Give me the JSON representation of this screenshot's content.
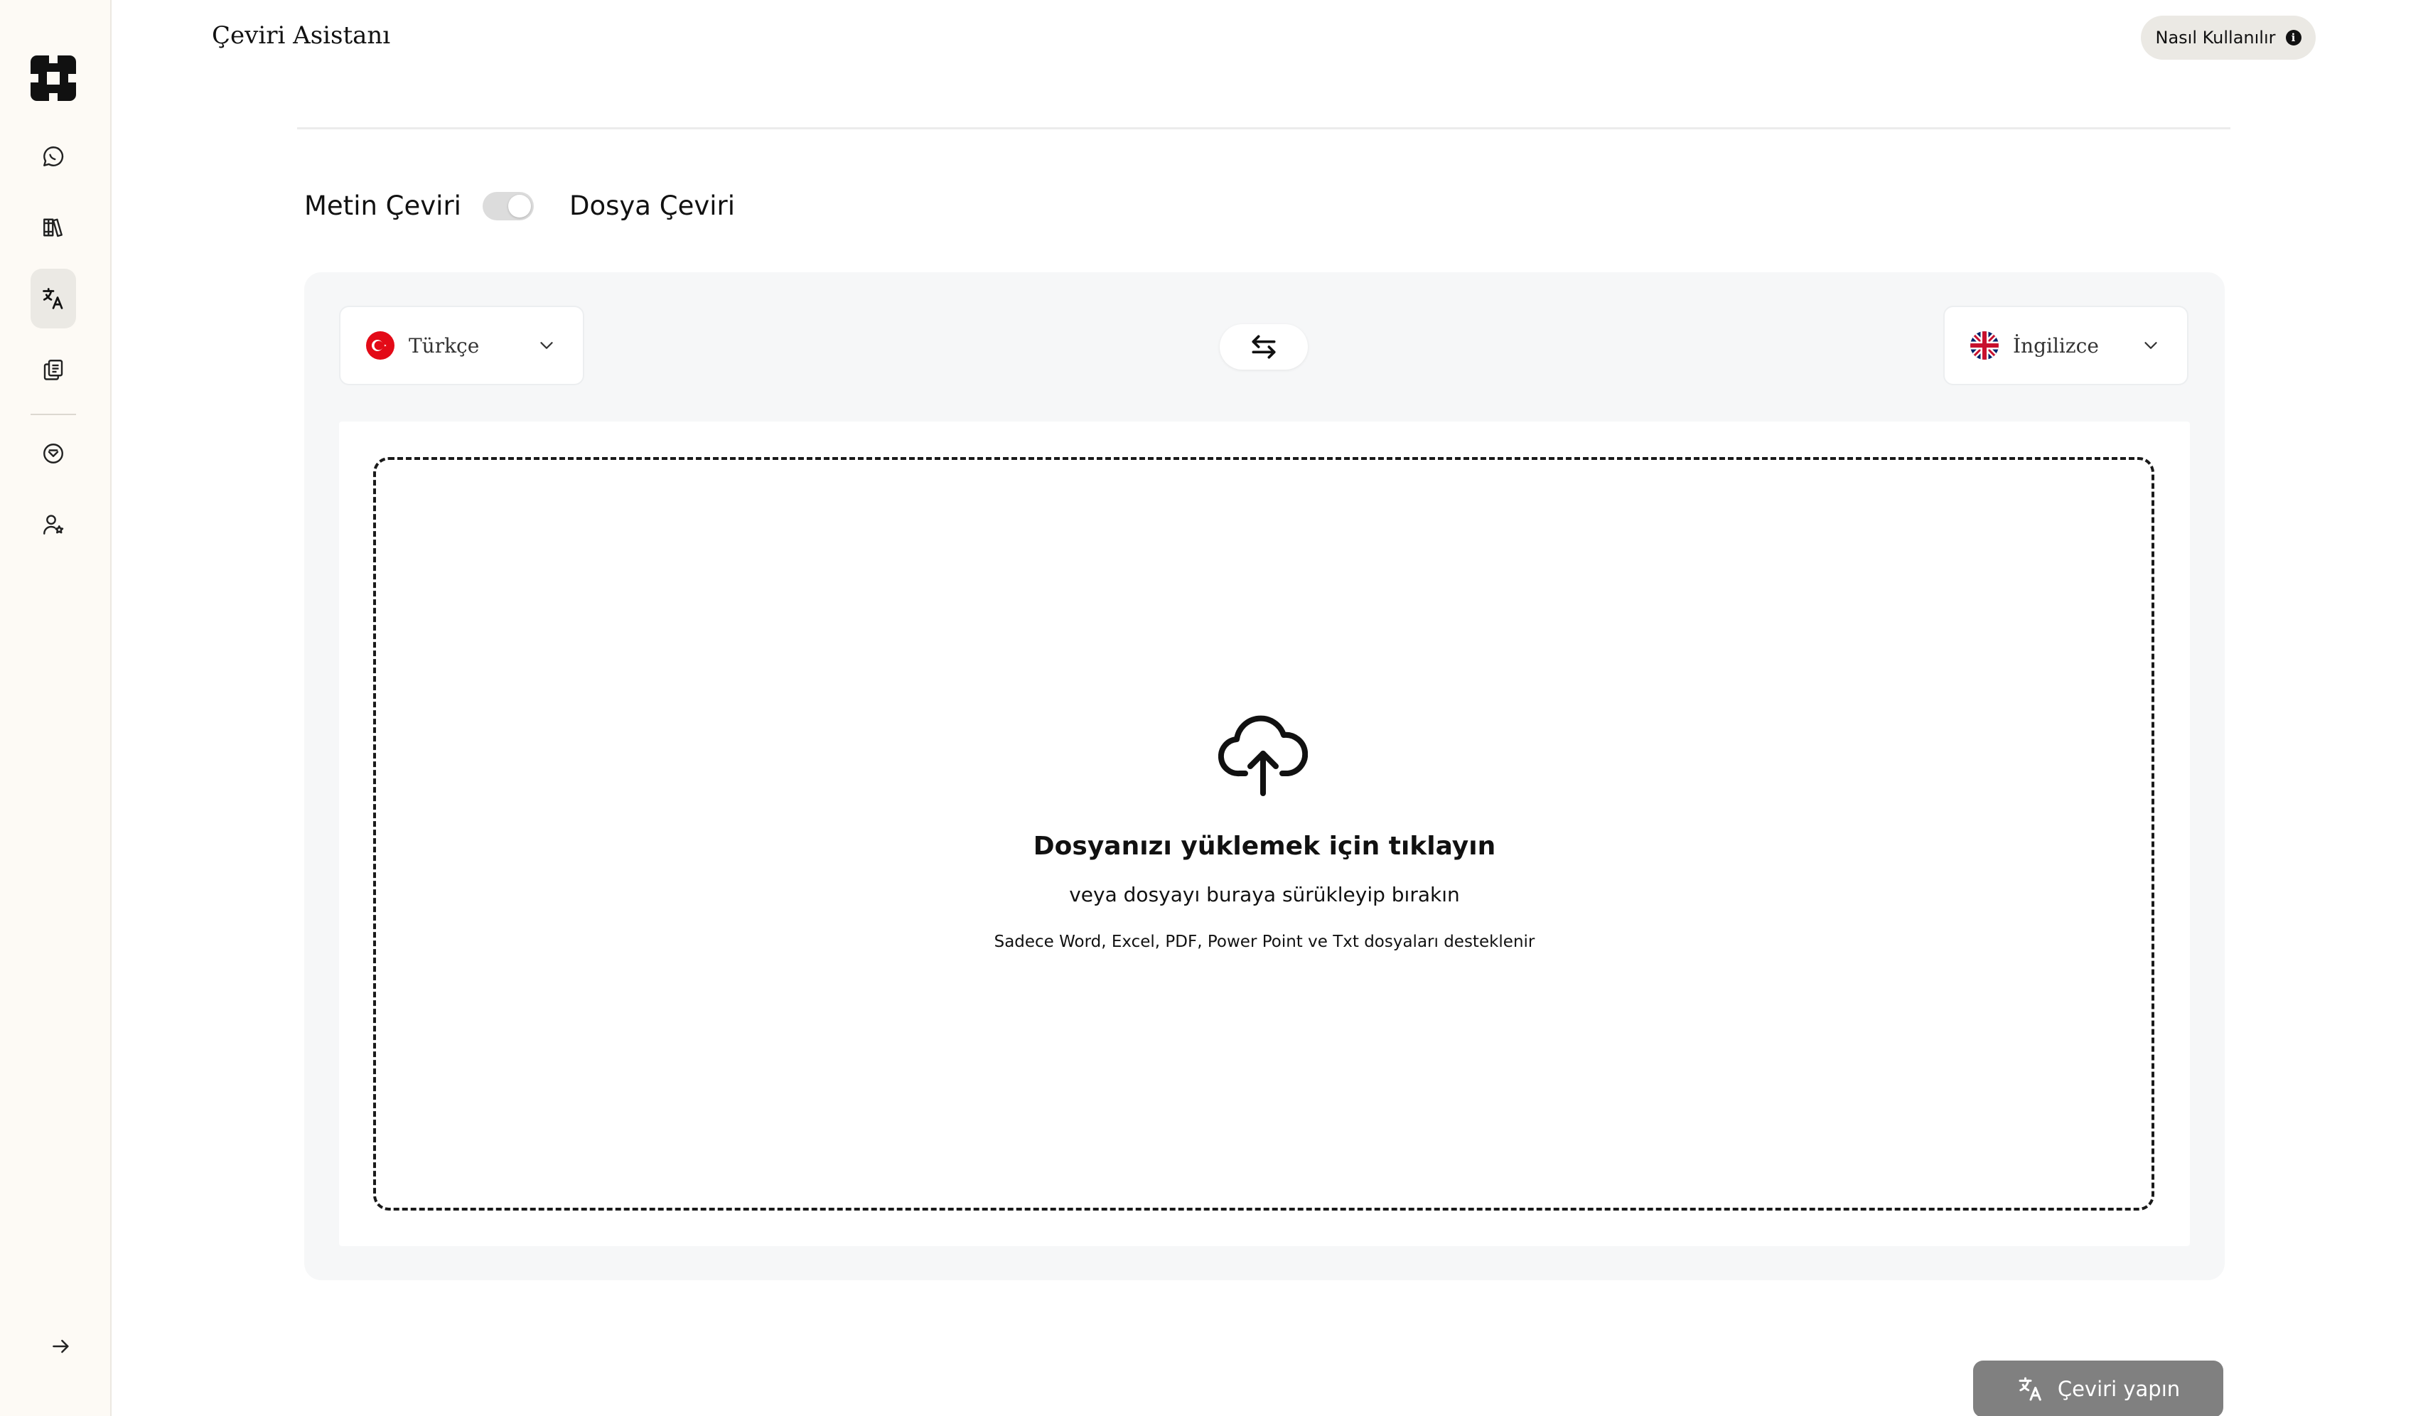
{
  "app": {
    "title": "Çeviri Asistanı",
    "help_label": "Nasıl Kullanılır"
  },
  "sidebar": {
    "items": [
      {
        "id": "chat",
        "icon": "chat-bubble-icon",
        "active": false
      },
      {
        "id": "library",
        "icon": "books-icon",
        "active": false
      },
      {
        "id": "translate",
        "icon": "translate-icon",
        "active": true
      },
      {
        "id": "documents",
        "icon": "documents-icon",
        "active": false
      },
      {
        "id": "verified",
        "icon": "shield-check-icon",
        "active": false
      },
      {
        "id": "account",
        "icon": "user-star-icon",
        "active": false
      }
    ],
    "collapse_icon": "arrow-right-icon"
  },
  "mode": {
    "text_label": "Metin Çeviri",
    "file_label": "Dosya Çeviri",
    "selected": "file"
  },
  "languages": {
    "source": "Türkçe",
    "target": "İngilizce"
  },
  "dropzone": {
    "title": "Dosyanızı yüklemek için tıklayın",
    "subtitle": "veya dosyayı buraya sürükleyip bırakın",
    "note": "Sadece Word, Excel, PDF, Power Point ve Txt dosyaları desteklenir"
  },
  "actions": {
    "translate_label": "Çeviri yapın"
  },
  "colors": {
    "sidebar_bg": "#fdfaf5",
    "panel_bg": "#f6f7f8",
    "active_nav": "#ebe9e4",
    "button_disabled": "#808080"
  }
}
